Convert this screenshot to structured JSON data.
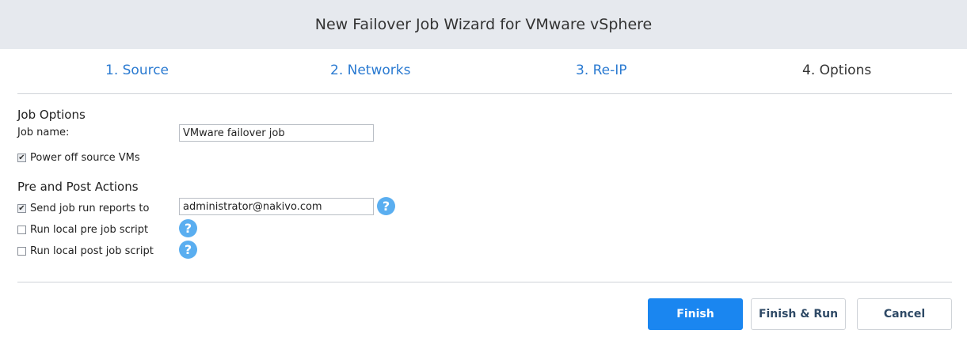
{
  "header": {
    "title": "New Failover Job Wizard for VMware vSphere"
  },
  "tabs": [
    {
      "label": "1. Source",
      "active": false
    },
    {
      "label": "2. Networks",
      "active": false
    },
    {
      "label": "3. Re-IP",
      "active": false
    },
    {
      "label": "4. Options",
      "active": true
    }
  ],
  "job_options": {
    "heading": "Job Options",
    "job_name_label": "Job name:",
    "job_name_value": "VMware failover job",
    "power_off": {
      "label": "Power off source VMs",
      "checked": true
    }
  },
  "pre_post": {
    "heading": "Pre and Post Actions",
    "send_reports": {
      "label": "Send job run reports to",
      "checked": true,
      "value": "administrator@nakivo.com"
    },
    "pre_script": {
      "label": "Run local pre job script",
      "checked": false
    },
    "post_script": {
      "label": "Run local post job script",
      "checked": false
    },
    "help_glyph": "?"
  },
  "buttons": {
    "finish": "Finish",
    "finish_run": "Finish & Run",
    "cancel": "Cancel"
  },
  "colors": {
    "accent": "#1a86f0",
    "link": "#2a7ad1",
    "help": "#5aaef0",
    "header_bg": "#e6e9ee"
  },
  "icons": {
    "checkbox_checked": "check-icon",
    "help": "help-icon"
  }
}
